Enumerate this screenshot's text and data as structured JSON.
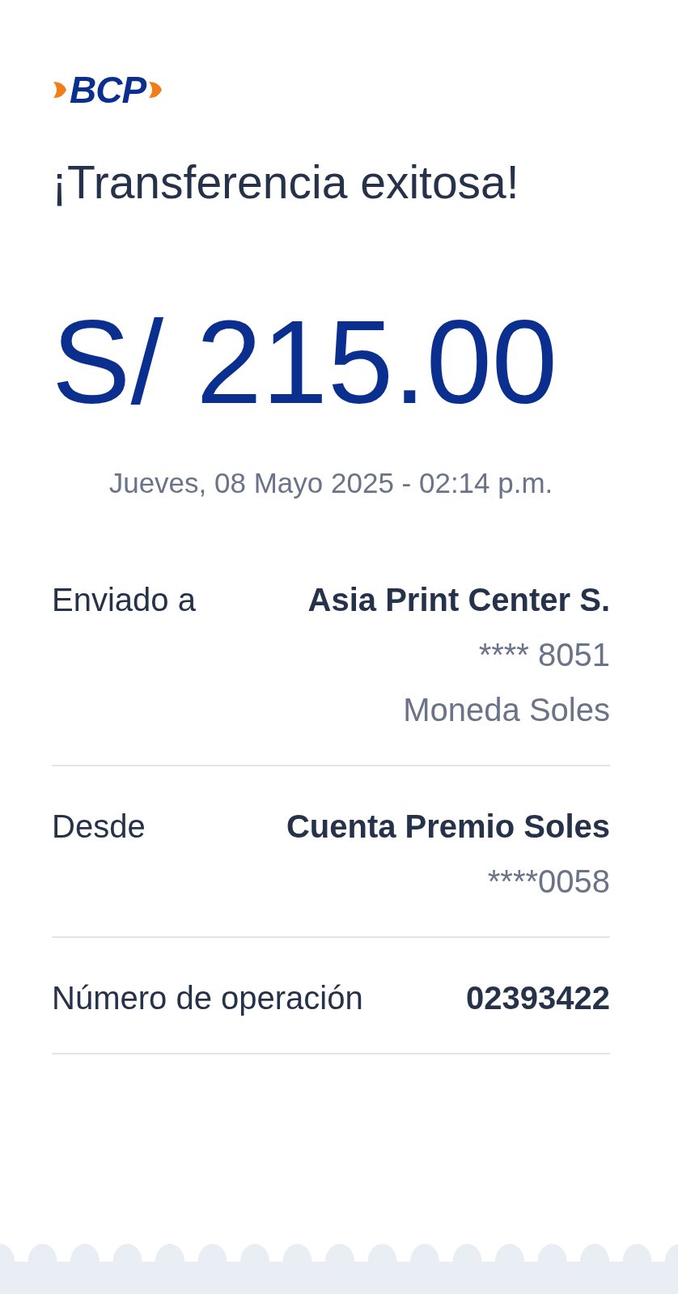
{
  "logo": {
    "text": "BCP"
  },
  "title": "¡Transferencia exitosa!",
  "amount": "S/ 215.00",
  "datetime": "Jueves, 08 Mayo 2025 - 02:14 p.m.",
  "details": [
    {
      "label": "Enviado a",
      "value": "Asia Print Center S.",
      "lines": [
        "**** 8051",
        "Moneda Soles"
      ]
    },
    {
      "label": "Desde",
      "value": "Cuenta Premio Soles",
      "lines": [
        "****0058"
      ]
    },
    {
      "label": "Número de operación",
      "value": "02393422"
    }
  ]
}
